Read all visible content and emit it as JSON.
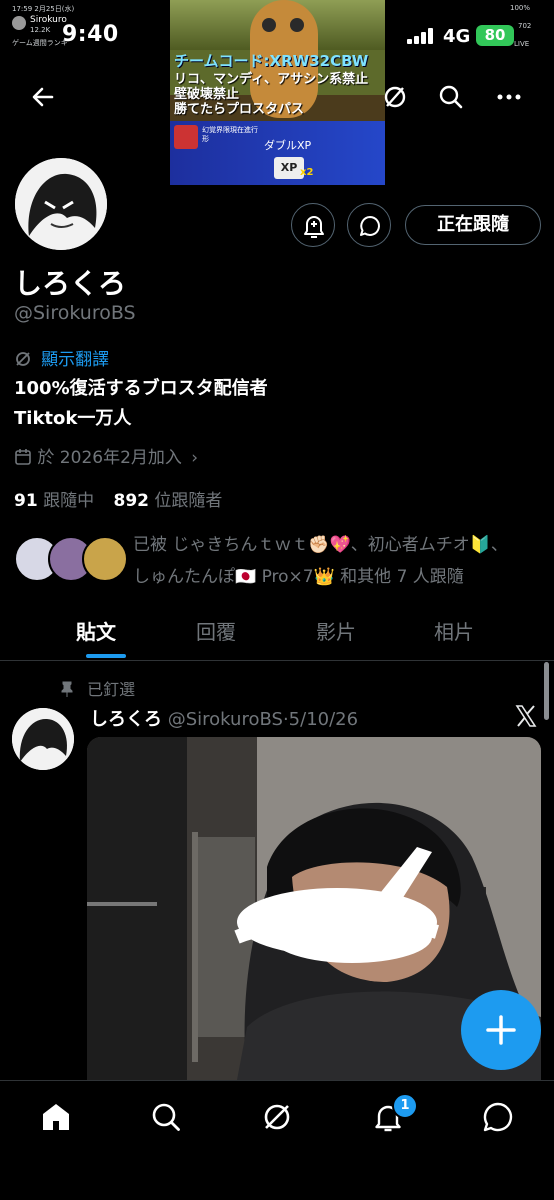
{
  "status_bar": {
    "time": "9:40",
    "network": "4G",
    "battery": "80",
    "overlay_left": {
      "date": "17:59  2月25日(水)",
      "channel": "Sirokuro",
      "viewers": "12.2K",
      "ticker": "ゲーム週間ランキ"
    },
    "overlay_right": {
      "battery": "100%",
      "count": "702",
      "ticker": "LIVE"
    }
  },
  "stream_overlay": {
    "code_line": "チームコード:XRW32CBW",
    "rule_1": "リコ、マンディ、アサシン系禁止",
    "rule_2": "壁破壊禁止",
    "rule_3": "勝てたらプロスタパス",
    "card_title": "幻覚界限現在進行",
    "card_sub": "形",
    "card_label": "ダブルXP",
    "card_badge": "XP",
    "card_mult": "x2"
  },
  "profile": {
    "display_name": "しろくろ",
    "handle": "@SirokuroBS",
    "translate_label": "顯示翻譯",
    "bio_line1": "100%復活するブロスタ配信者",
    "bio_line2": "Tiktok一万人",
    "joined": "於 2026年2月加入",
    "following_count": "91",
    "following_label": "跟隨中",
    "followers_count": "892",
    "followers_label": "位跟隨者",
    "follow_button": "正在跟隨",
    "followed_by_line1": "已被 じゃきちんｔｗｔ✊🏻💖、初心者ムチオ🔰、",
    "followed_by_line2": "しゅんたんぽ🇯🇵 Pro×7👑 和其他 7 人跟隨"
  },
  "tabs": [
    {
      "label": "貼文"
    },
    {
      "label": "回覆"
    },
    {
      "label": "影片"
    },
    {
      "label": "相片"
    }
  ],
  "post": {
    "pinned_label": "已釘選",
    "author": "しろくろ",
    "handle": "@SirokuroBS",
    "date": "5/10/26",
    "separator": "·"
  },
  "bottom_nav": {
    "notification_badge": "1"
  },
  "colors": {
    "accent": "#1d9bf0",
    "background": "#000000",
    "secondary_text": "#71767b"
  }
}
